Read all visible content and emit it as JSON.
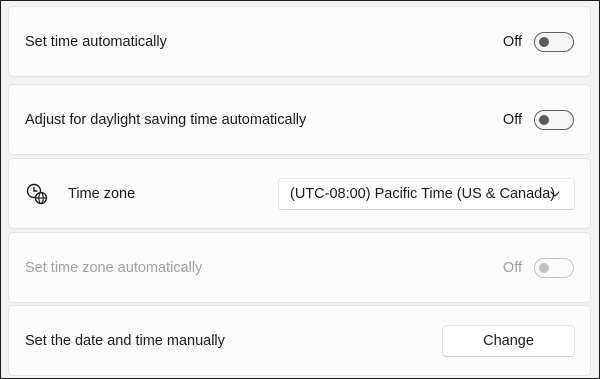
{
  "rows": {
    "set_time_auto": {
      "label": "Set time automatically",
      "state": "Off",
      "on": false
    },
    "daylight": {
      "label": "Adjust for daylight saving time automatically",
      "state": "Off",
      "on": false
    },
    "time_zone": {
      "label": "Time zone",
      "selected": "(UTC-08:00) Pacific Time (US & Canada)",
      "icon": "clock-globe-icon"
    },
    "set_tz_auto": {
      "label": "Set time zone automatically",
      "state": "Off",
      "on": false,
      "disabled": true
    },
    "manual": {
      "label": "Set the date and time manually",
      "button": "Change"
    }
  },
  "colors": {
    "background": "#f3f3f3",
    "card": "#fbfbfb",
    "disabled_text": "#a0a0a0"
  }
}
